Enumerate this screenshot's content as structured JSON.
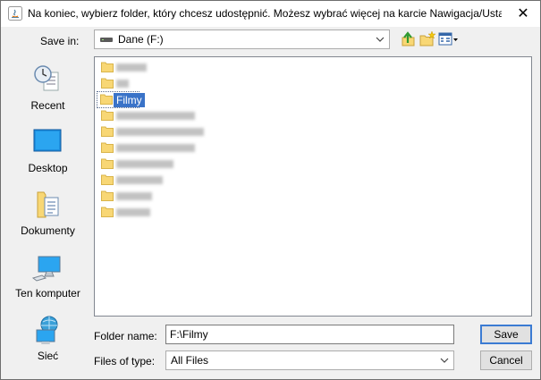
{
  "window": {
    "title": "Na koniec, wybierz folder, który chcesz udostępnić. Możesz wybrać więcej na karcie Nawigacja/Ustawieni..."
  },
  "toolbar": {
    "save_in_label": "Save in:",
    "save_in_value": "Dane (F:)",
    "icons": [
      "up-folder-icon",
      "new-folder-icon",
      "view-menu-icon"
    ]
  },
  "sidebar": {
    "items": [
      {
        "label": "Recent",
        "icon": "recent-icon"
      },
      {
        "label": "Desktop",
        "icon": "desktop-icon"
      },
      {
        "label": "Dokumenty",
        "icon": "documents-icon"
      },
      {
        "label": "Ten komputer",
        "icon": "computer-icon"
      },
      {
        "label": "Sieć",
        "icon": "network-icon"
      }
    ]
  },
  "file_list": {
    "selected": "Filmy"
  },
  "form": {
    "folder_name_label": "Folder name:",
    "folder_name_value": "F:\\Filmy",
    "files_of_type_label": "Files of type:",
    "files_of_type_value": "All Files",
    "save_label": "Save",
    "cancel_label": "Cancel"
  },
  "colors": {
    "selection": "#3a73c8",
    "folder": "#f8d775",
    "default_button_border": "#3b7bd3"
  }
}
